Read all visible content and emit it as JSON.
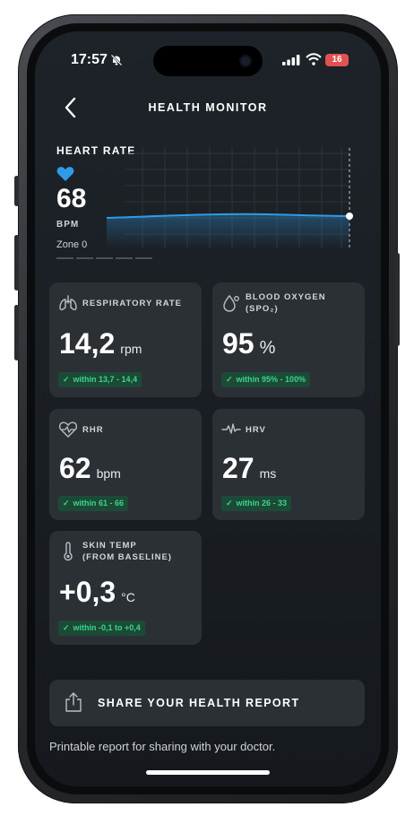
{
  "status": {
    "time": "17:57",
    "battery": "16"
  },
  "nav": {
    "title": "HEALTH MONITOR"
  },
  "heart": {
    "label": "HEART RATE",
    "value": "68",
    "unit": "BPM",
    "zone": "Zone 0"
  },
  "metrics": [
    {
      "label_line1": "RESPIRATORY RATE",
      "label_line2": "",
      "value": "14,2",
      "unit": "rpm",
      "range": "within 13,7 - 14,4",
      "icon": "lungs-icon"
    },
    {
      "label_line1": "BLOOD OXYGEN",
      "label_line2": "(SPO₂)",
      "value": "95",
      "unit": "%",
      "range": "within 95% - 100%",
      "icon": "drop-icon"
    },
    {
      "label_line1": "RHR",
      "label_line2": "",
      "value": "62",
      "unit": "bpm",
      "range": "within 61 - 66",
      "icon": "heart-pulse-icon"
    },
    {
      "label_line1": "HRV",
      "label_line2": "",
      "value": "27",
      "unit": "ms",
      "range": "within 26 - 33",
      "icon": "hrv-icon"
    },
    {
      "label_line1": "SKIN TEMP",
      "label_line2": "(FROM BASELINE)",
      "value": "+0,3",
      "unit": "°C",
      "range": "within -0,1 to +0,4",
      "icon": "thermometer-icon"
    }
  ],
  "share": {
    "label": "SHARE YOUR HEALTH REPORT",
    "description": "Printable report for sharing with your doctor."
  },
  "colors": {
    "accent": "#2f9be8",
    "badge_text": "#3bd48b",
    "badge_bg": "#1c4a37",
    "card_bg": "#2b3035"
  }
}
